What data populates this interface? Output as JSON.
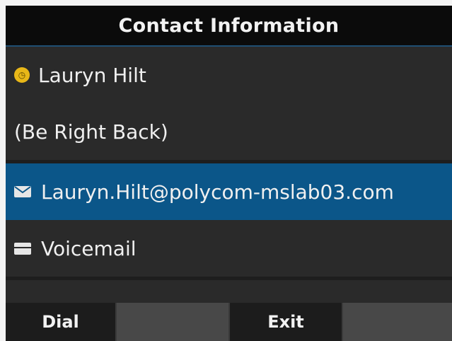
{
  "header": {
    "title": "Contact Information"
  },
  "contact": {
    "name": "Lauryn Hilt",
    "status": "(Be Right Back)",
    "email": "Lauryn.Hilt@polycom-mslab03.com",
    "voicemail_label": "Voicemail",
    "presence_color": "#e8b718"
  },
  "softkeys": {
    "dial": "Dial",
    "blank1": "",
    "exit": "Exit",
    "blank2": ""
  },
  "colors": {
    "selection": "#0b5689",
    "background": "#2a2a2a",
    "titlebar": "#0b0b0b"
  },
  "icons": {
    "presence": "presence-away-icon",
    "email": "envelope-icon",
    "voicemail": "voicemail-icon"
  }
}
